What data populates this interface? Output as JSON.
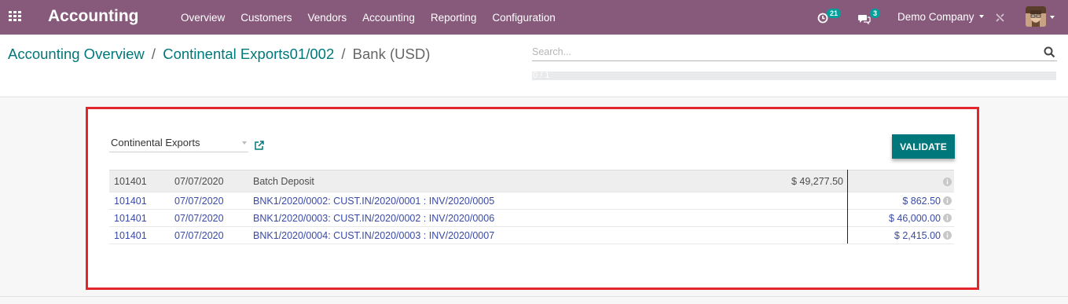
{
  "navbar": {
    "app_title": "Accounting",
    "menu": [
      "Overview",
      "Customers",
      "Vendors",
      "Accounting",
      "Reporting",
      "Configuration"
    ],
    "activity_count": "21",
    "messages_count": "3",
    "company": "Demo Company",
    "icons": [
      "apps-grid-icon",
      "clock-icon",
      "chat-icon",
      "debug-tools-icon",
      "avatar"
    ]
  },
  "breadcrumb": {
    "items": [
      "Accounting Overview",
      "Continental Exports01/002"
    ],
    "current": "Bank (USD)"
  },
  "search": {
    "placeholder": "Search...",
    "value": ""
  },
  "pager": {
    "text": "0 / 1"
  },
  "reconcile": {
    "partner": "Continental Exports",
    "validate_label": "VALIDATE",
    "header_row": {
      "account": "101401",
      "date": "07/07/2020",
      "label": "Batch Deposit",
      "debit": "$ 49,277.50",
      "credit": ""
    },
    "lines": [
      {
        "account": "101401",
        "date": "07/07/2020",
        "label": "BNK1/2020/0002: CUST.IN/2020/0001 : INV/2020/0005",
        "amount": "$ 862.50"
      },
      {
        "account": "101401",
        "date": "07/07/2020",
        "label": "BNK1/2020/0003: CUST.IN/2020/0002 : INV/2020/0006",
        "amount": "$ 46,000.00"
      },
      {
        "account": "101401",
        "date": "07/07/2020",
        "label": "BNK1/2020/0004: CUST.IN/2020/0003 : INV/2020/0007",
        "amount": "$ 2,415.00"
      }
    ]
  },
  "colors": {
    "navbar": "#875a7b",
    "link": "#00787b",
    "button": "#00787b",
    "highlight_border": "#e3262e",
    "line_text": "#3a4aa6"
  }
}
